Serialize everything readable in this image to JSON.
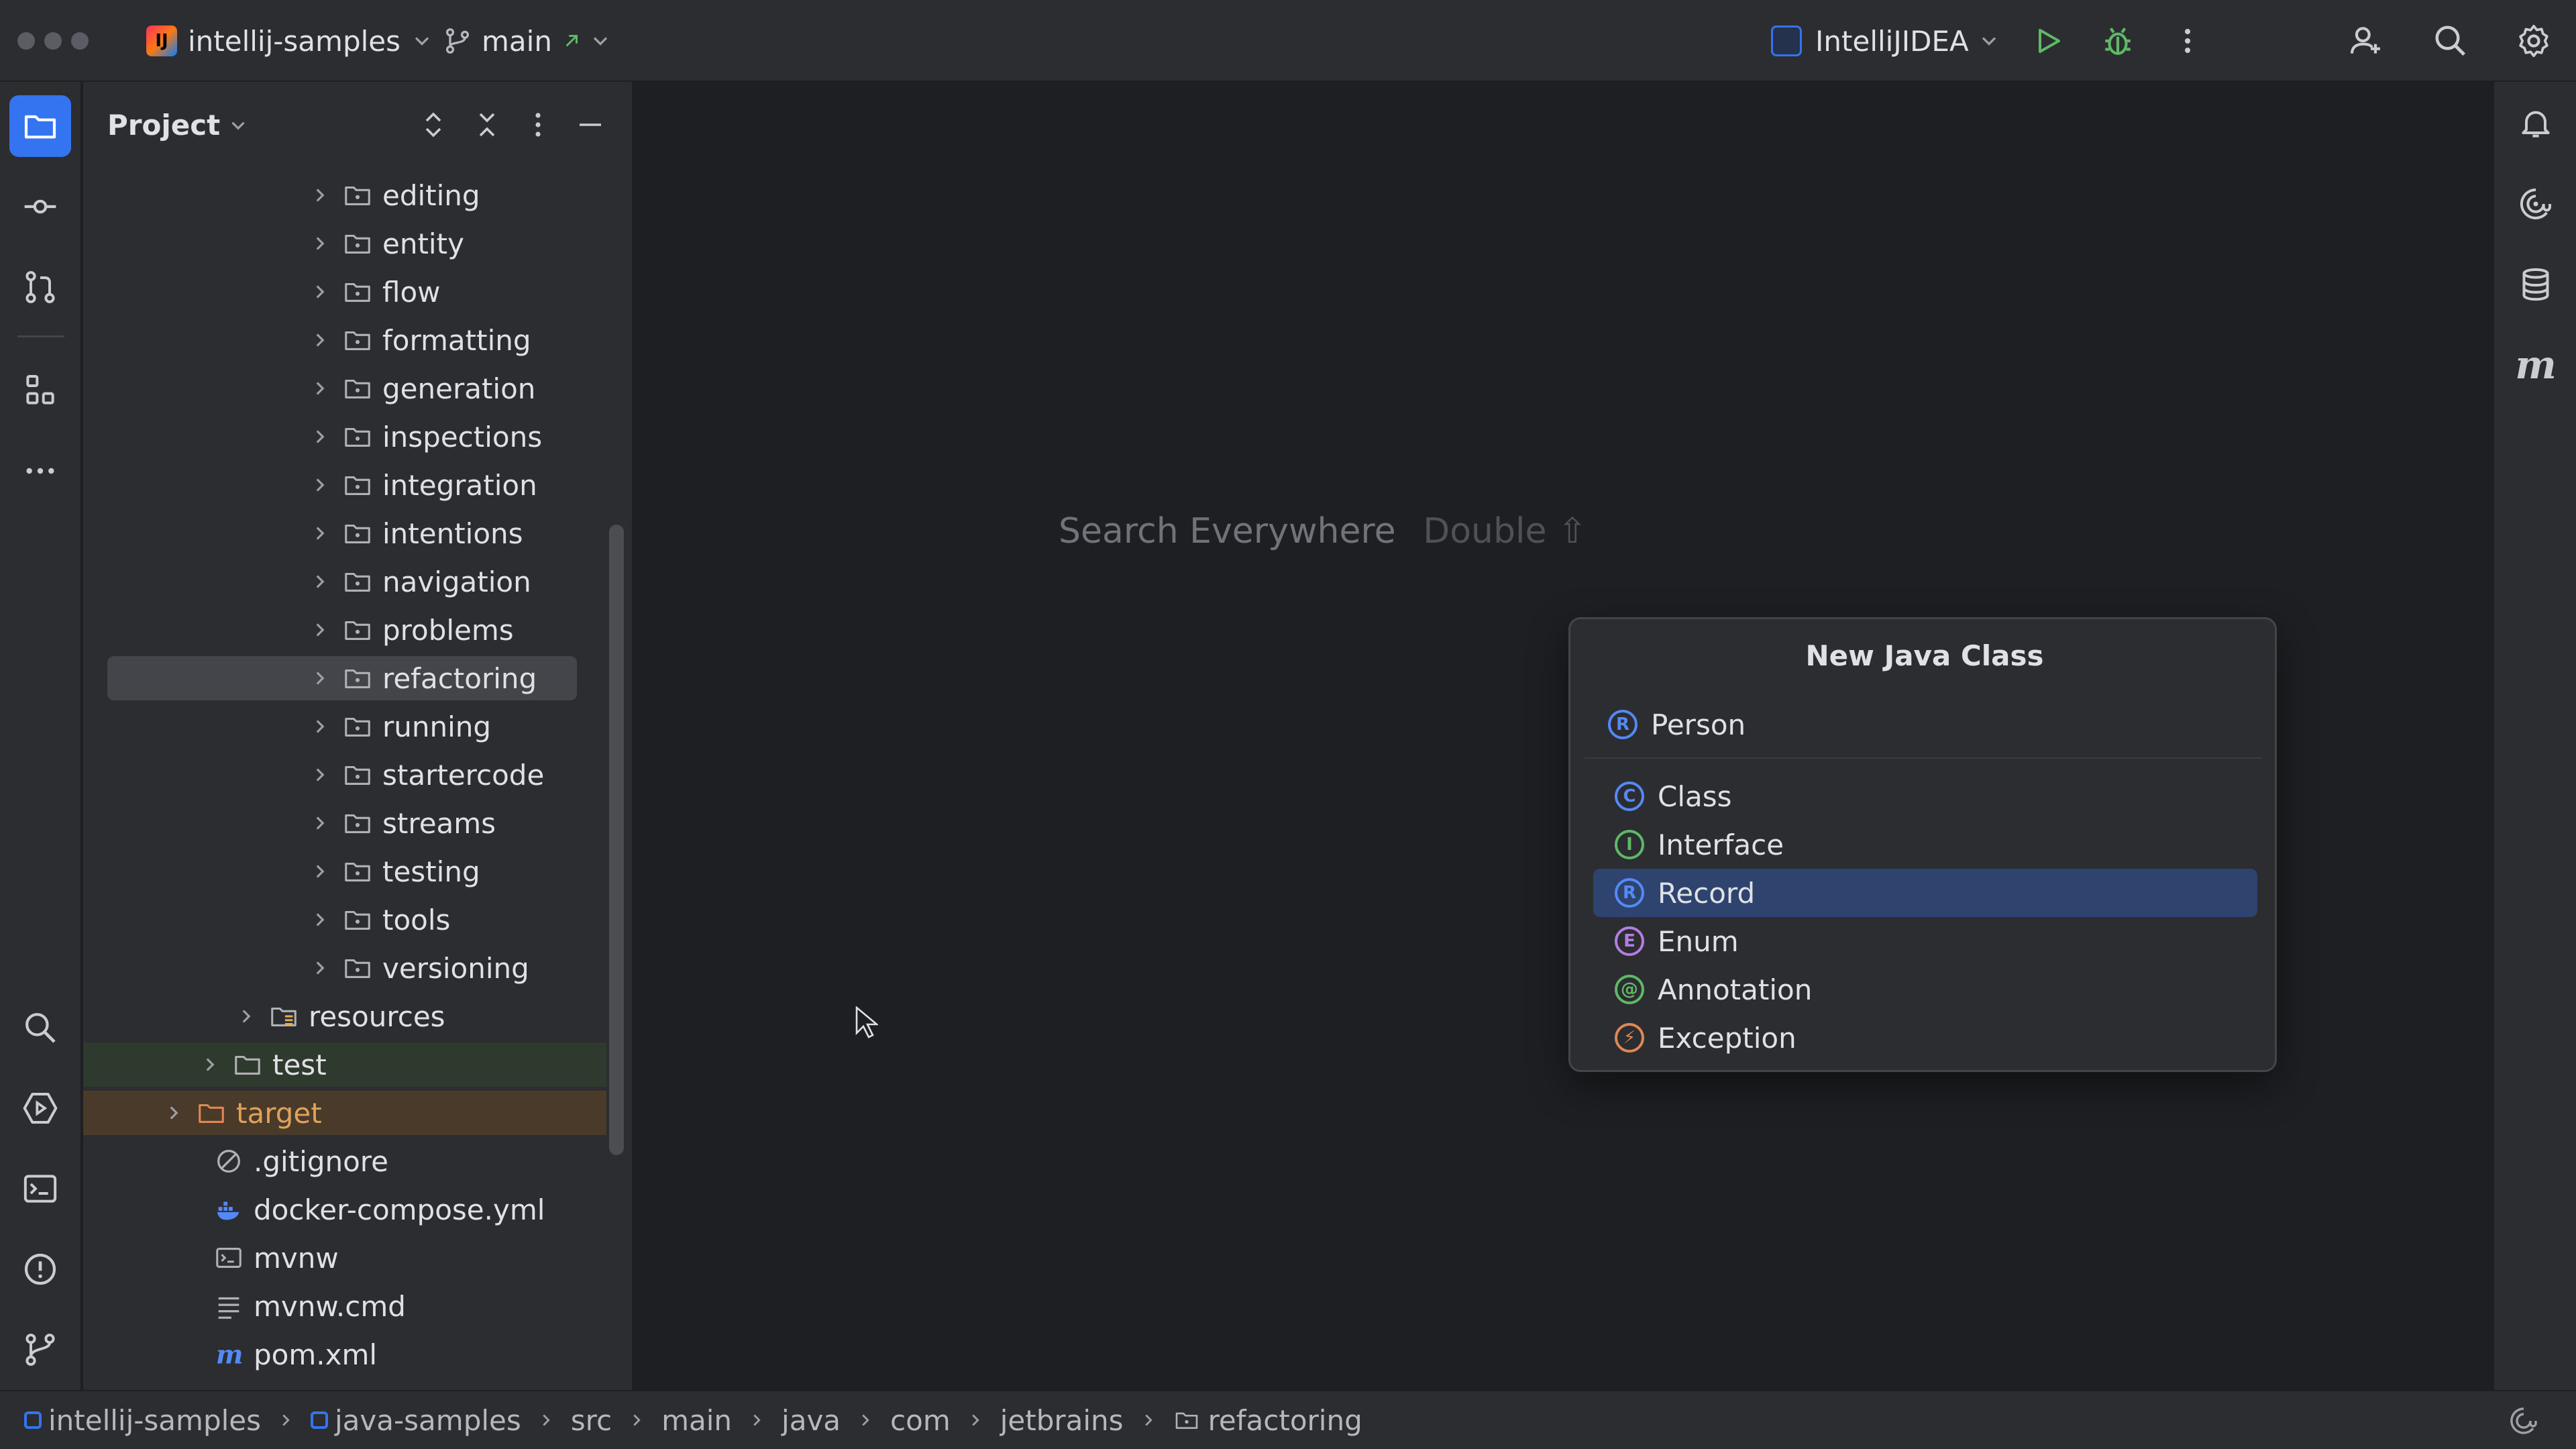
{
  "titlebar": {
    "project_badge": "IJ",
    "project_name": "intellij-samples",
    "branch": "main",
    "run_config": "IntelliJIDEA",
    "icons": [
      "traffic-lights",
      "project-badge-icon",
      "branch-icon",
      "run-config-icon",
      "run-icon",
      "debug-icon",
      "more-vertical-icon",
      "add-user-icon",
      "search-icon",
      "settings-icon"
    ]
  },
  "left_stripe": {
    "icons": [
      "folder-icon",
      "commit-icon",
      "pull-request-icon",
      "structure-icon",
      "more-horizontal-icon",
      "find-icon",
      "services-icon",
      "terminal-icon",
      "problems-icon",
      "git-icon"
    ]
  },
  "right_stripe": {
    "icons": [
      "notifications-icon",
      "ai-assistant-icon",
      "database-icon",
      "maven-icon"
    ]
  },
  "project_panel": {
    "title": "Project",
    "toolbar_icons": [
      "expand-all-icon",
      "collapse-all-icon",
      "options-icon",
      "hide-icon"
    ],
    "tree": [
      {
        "label": "editing",
        "type": "package"
      },
      {
        "label": "entity",
        "type": "package"
      },
      {
        "label": "flow",
        "type": "package"
      },
      {
        "label": "formatting",
        "type": "package"
      },
      {
        "label": "generation",
        "type": "package"
      },
      {
        "label": "inspections",
        "type": "package"
      },
      {
        "label": "integration",
        "type": "package"
      },
      {
        "label": "intentions",
        "type": "package"
      },
      {
        "label": "navigation",
        "type": "package"
      },
      {
        "label": "problems",
        "type": "package"
      },
      {
        "label": "refactoring",
        "type": "package"
      },
      {
        "label": "running",
        "type": "package"
      },
      {
        "label": "startercode",
        "type": "package"
      },
      {
        "label": "streams",
        "type": "package"
      },
      {
        "label": "testing",
        "type": "package"
      },
      {
        "label": "tools",
        "type": "package"
      },
      {
        "label": "versioning",
        "type": "package"
      },
      {
        "label": "resources",
        "type": "resources-folder"
      },
      {
        "label": "test",
        "type": "folder"
      },
      {
        "label": "target",
        "type": "folder"
      },
      {
        "label": ".gitignore",
        "type": "ignore-file"
      },
      {
        "label": "docker-compose.yml",
        "type": "docker-file"
      },
      {
        "label": "mvnw",
        "type": "script-file"
      },
      {
        "label": "mvnw.cmd",
        "type": "text-file"
      },
      {
        "label": "pom.xml",
        "type": "maven-file"
      }
    ]
  },
  "editor": {
    "hint_action": "Search Everywhere",
    "hint_shortcut": "Double ⇧"
  },
  "new_class_popup": {
    "title": "New Java Class",
    "name_value": "Person",
    "name_kind_letter": "R",
    "kinds": [
      {
        "label": "Class",
        "letter": "C",
        "color": "#548af7"
      },
      {
        "label": "Interface",
        "letter": "I",
        "color": "#5fb865"
      },
      {
        "label": "Record",
        "letter": "R",
        "color": "#548af7"
      },
      {
        "label": "Enum",
        "letter": "E",
        "color": "#b27fe0"
      },
      {
        "label": "Annotation",
        "letter": "@",
        "color": "#5fb865"
      },
      {
        "label": "Exception",
        "letter": "⚡",
        "color": "#e08855"
      }
    ],
    "selected_kind": "Record"
  },
  "breadcrumb": [
    "intellij-samples",
    "java-samples",
    "src",
    "main",
    "java",
    "com",
    "jetbrains",
    "refactoring"
  ],
  "colors": {
    "accent": "#3574f0",
    "selection": "#2e436e",
    "run_green": "#5fb865"
  }
}
